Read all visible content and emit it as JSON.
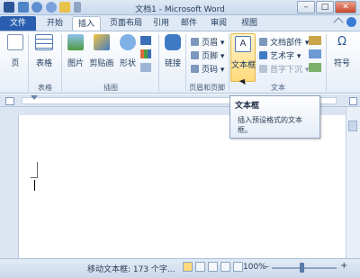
{
  "title": "文档1 - Microsoft Word",
  "window_buttons": {
    "minimize": "–",
    "maximize": "□",
    "close": "✕"
  },
  "tabs": [
    "文件",
    "开始",
    "插入",
    "页面布局",
    "引用",
    "邮件",
    "审阅",
    "视图"
  ],
  "active_tab": "插入",
  "ribbon": {
    "pages_group": {
      "page_label": "页",
      "group_label": ""
    },
    "table_group": {
      "table_label": "表格",
      "group_label": "表格"
    },
    "illustrations_group": {
      "picture_label": "图片",
      "clipart_label": "剪贴画",
      "shapes_label": "形状",
      "group_label": "插图"
    },
    "links_group": {
      "link_label": "链接"
    },
    "header_footer_group": {
      "header_label": "页眉",
      "footer_label": "页脚",
      "pagenum_label": "页码",
      "group_label": "页眉和页脚"
    },
    "text_group": {
      "textbox_label": "文本框",
      "parts_label": "文档部件",
      "wordart_label": "艺术字",
      "dropcap_label": "首字下沉",
      "group_label": "文本"
    },
    "symbol_group": {
      "symbol_label": "符号",
      "omega": "Ω"
    }
  },
  "tooltip": {
    "title": "文本框",
    "desc_line1": "插入预设格式的文本",
    "desc_line2": "框。"
  },
  "status": {
    "text": "移动文本框: 173 个字...",
    "zoom": "100%",
    "minus": "–",
    "plus": "+"
  },
  "colors": {
    "file_tab": "#2a5fb0",
    "ribbon_bg": "#e7eef8",
    "highlight": "#ffd97a"
  }
}
